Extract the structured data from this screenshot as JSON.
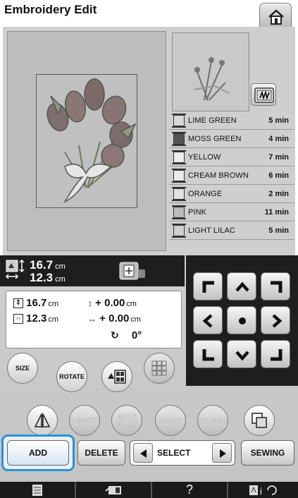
{
  "header": {
    "title": "Embroidery Edit"
  },
  "colors": [
    {
      "name": "LIME GREEN",
      "time": "5 min"
    },
    {
      "name": "MOSS GREEN",
      "time": "4 min"
    },
    {
      "name": "YELLOW",
      "time": "7 min"
    },
    {
      "name": "CREAM BROWN",
      "time": "6 min"
    },
    {
      "name": "ORANGE",
      "time": "2 min"
    },
    {
      "name": "PINK",
      "time": "11 min"
    },
    {
      "name": "LIGHT LILAC",
      "time": "5 min"
    }
  ],
  "pattern_size": {
    "height": "16.7",
    "width": "12.3",
    "unit": "cm"
  },
  "edit_panel": {
    "height": "16.7",
    "width": "12.3",
    "unit": "cm",
    "offset_v": "+ 0.00",
    "offset_h": "+ 0.00",
    "rotation": "0°"
  },
  "tools": {
    "size": "SIZE",
    "rotate": "ROTATE",
    "density": "DENSITY",
    "multi": "MULTI",
    "color": "COLOR",
    "array": "ARRAY",
    "spacing": "SPACING"
  },
  "actions": {
    "add": "ADD",
    "delete": "DELETE",
    "select": "SELECT",
    "sewing": "SEWING"
  },
  "bottom": {
    "help": "?"
  }
}
